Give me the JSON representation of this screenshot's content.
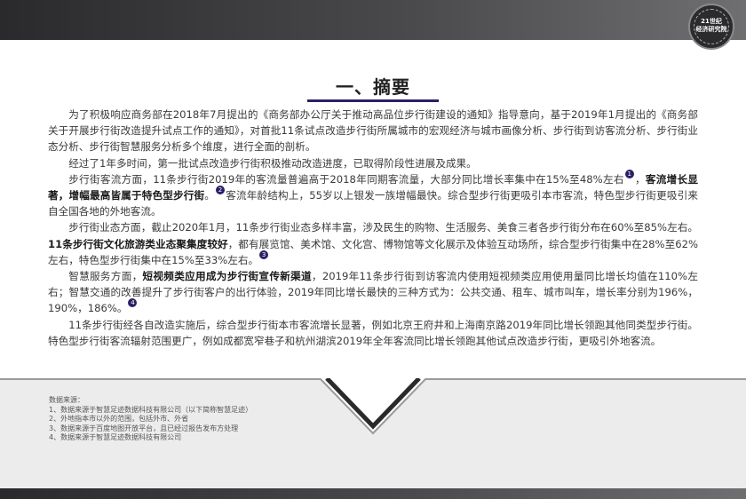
{
  "header": {
    "logo_text_line1": "21世纪",
    "logo_text_line2": "经济研究院"
  },
  "title": "一、摘要",
  "summary": {
    "p1": "为了积极响应商务部在2018年7月提出的《商务部办公厅关于推动高品位步行街建设的通知》指导意向，基于2019年1月提出的《商务部关于开展步行街改造提升试点工作的通知》，对首批11条试点改造步行街所属城市的宏观经济与城市画像分析、步行街到访客流分析、步行街业态分析、步行街智慧服务分析多个维度，进行全面的剖析。",
    "p2": "经过了1年多时间，第一批试点改造步行街积极推动改造进度，已取得阶段性进展及成果。",
    "p3_a": "步行街客流方面，11条步行街2019年的客流量普遍高于2018年同期客流量，大部分同比增长率集中在15%至48%左右",
    "p3_mark1": "1",
    "p3_b": "，",
    "p3_bold": "客流增长显著，增幅最高皆属于特色型步行街",
    "p3_c": "。",
    "p3_mark2": "2",
    "p3_d": "客流年龄结构上，55岁以上银发一族增幅最快。综合型步行街更吸引本市客流，特色型步行街更吸引来自全国各地的外地客流。",
    "p4_a": "步行街业态方面，截止2020年1月，11条步行街业态多样丰富，涉及民生的购物、生活服务、美食三者各步行街分布在60%至85%左右。",
    "p4_bold": "11条步行街文化旅游类业态聚集度较好",
    "p4_b": "，都有展览馆、美术馆、文化宫、博物馆等文化展示及体验互动场所，综合型步行街集中在28%至62%左右，特色型步行街集中在15%至33%左右。",
    "p4_mark": "3",
    "p5_a": "智慧服务方面，",
    "p5_bold": "短视频类应用成为步行街宣传新渠道",
    "p5_b": "，2019年11条步行街到访客流内使用短视频类应用使用量同比增长均值在110%左右；智慧交通的改善提升了步行街客户的出行体验，2019年同比增长最快的三种方式为：公共交通、租车、城市叫车，增长率分别为196%，190%，186%。",
    "p5_mark": "4",
    "p6": "11条步行街经各自改造实施后，综合型步行街本市客流增长显著，例如北京王府井和上海南京路2019年同比增长领跑其他同类型步行街。特色型步行街客流辐射范围更广，例如成都宽窄巷子和杭州湖滨2019年全年客流同比增长领跑其他试点改造步行街，更吸引外地客流。"
  },
  "sources": {
    "heading": "数据来源：",
    "items": [
      "1、数据来源于智慧足迹数据科技有限公司（以下简称智慧足迹）",
      "2、外地指本市以外的范围，包括外市、外省",
      "3、数据来源于百度地图开放平台，且已经过报告发布方处理",
      "4、数据来源于智慧足迹数据科技有限公司"
    ]
  },
  "colors": {
    "accent": "#2b1f66",
    "header_dark": "#2a2a2c",
    "panel_bg": "#ececec"
  }
}
